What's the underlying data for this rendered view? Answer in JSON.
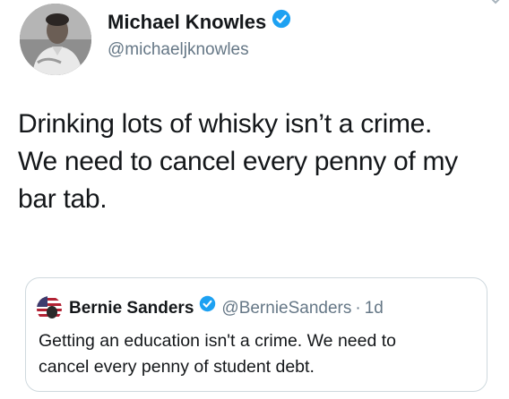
{
  "tweet": {
    "author": {
      "name": "Michael Knowles",
      "handle": "@michaeljknowles",
      "verified": true,
      "avatar_icon": "person-photo"
    },
    "text_lines": [
      "Drinking lots of whisky isn’t a crime.",
      "We need to cancel every penny of my",
      "bar tab."
    ],
    "quoted": {
      "author_name": "Bernie Sanders",
      "handle": "@BernieSanders",
      "separator": "·",
      "time": "1d",
      "verified": true,
      "avatar_icon": "flag-avatar",
      "text_lines": [
        "Getting an education isn't a crime. We need to",
        "cancel every penny of student debt."
      ]
    }
  },
  "colors": {
    "verified_blue": "#1da1f2",
    "secondary_text": "#657786",
    "primary_text": "#14171a",
    "border": "#cfd9de"
  },
  "icons": {
    "verified": "verified-badge-icon",
    "more": "chevron-down-icon"
  }
}
